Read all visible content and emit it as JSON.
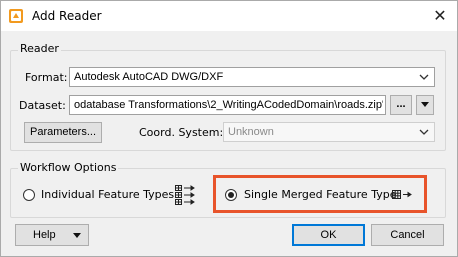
{
  "window": {
    "title": "Add Reader",
    "close_glyph": "✕"
  },
  "reader": {
    "group_label": "Reader",
    "format_label": "Format:",
    "format_value": "Autodesk AutoCAD DWG/DXF",
    "dataset_label": "Dataset:",
    "dataset_value": "odatabase Transformations\\2_WritingACodedDomain\\roads.zip\"",
    "browse_label": "...",
    "parameters_label": "Parameters...",
    "coord_label": "Coord. System:",
    "coord_value": "Unknown"
  },
  "workflow": {
    "group_label": "Workflow Options",
    "option_individual": "Individual Feature Types",
    "option_single": "Single Merged Feature Type",
    "selected": "single"
  },
  "footer": {
    "help_label": "Help",
    "ok_label": "OK",
    "cancel_label": "Cancel"
  },
  "colors": {
    "highlight": "#e8542b",
    "focus": "#0078d7"
  },
  "icons": {
    "app": "fme-reader-icon",
    "individual": "multiple-feature-types-icon",
    "single": "merged-feature-type-icon"
  }
}
